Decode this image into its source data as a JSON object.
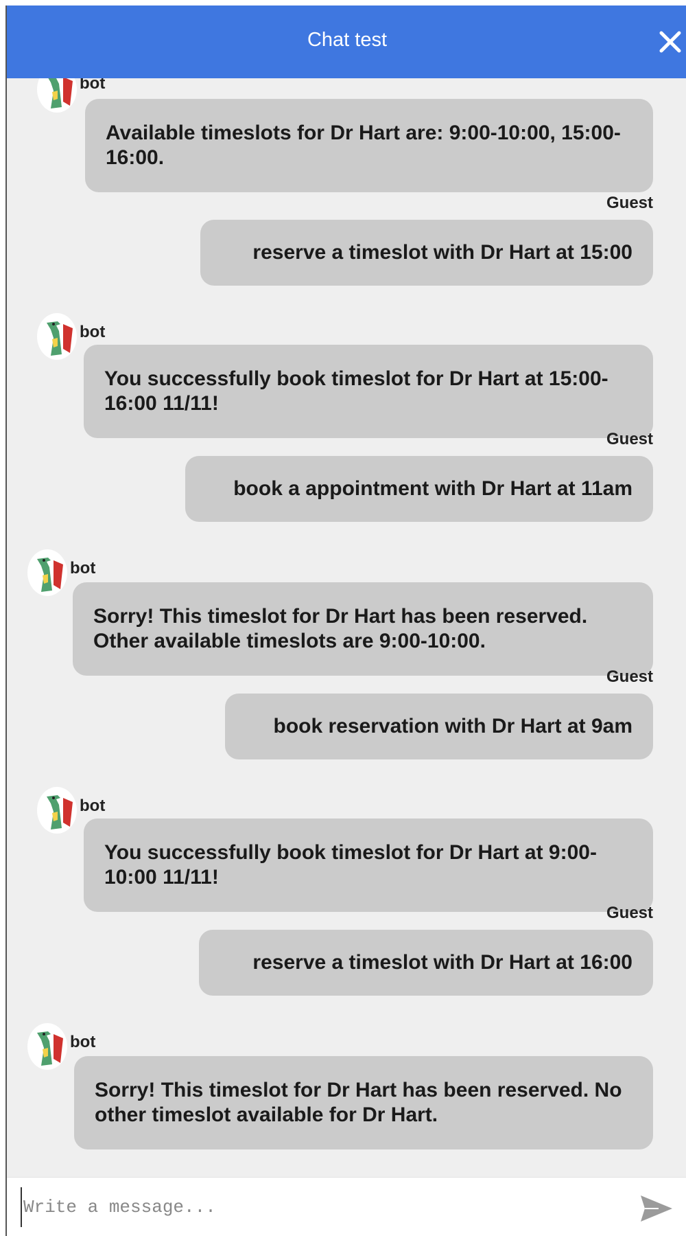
{
  "header": {
    "title": "Chat test",
    "close_icon": "close-icon"
  },
  "colors": {
    "header": "#3f77e0",
    "bubble": "#cbcbcb",
    "background": "#efefef"
  },
  "messages": [
    {
      "sender": "bot",
      "text": "Available timeslots for Dr Hart are: 9:00-10:00, 15:00-16:00."
    },
    {
      "sender": "Guest",
      "text": "reserve a timeslot with Dr Hart at 15:00"
    },
    {
      "sender": "bot",
      "text": "You successfully book timeslot for Dr Hart at 15:00-16:00 11/11!"
    },
    {
      "sender": "Guest",
      "text": "book a appointment with Dr Hart at 11am"
    },
    {
      "sender": "bot",
      "text": "Sorry! This timeslot for Dr Hart has been reserved. Other available timeslots are 9:00-10:00."
    },
    {
      "sender": "Guest",
      "text": "book reservation with Dr Hart at 9am"
    },
    {
      "sender": "bot",
      "text": "You successfully book timeslot for Dr Hart at 9:00-10:00 11/11!"
    },
    {
      "sender": "Guest",
      "text": "reserve a timeslot with Dr Hart at 16:00"
    },
    {
      "sender": "bot",
      "text": "Sorry! This timeslot for Dr Hart has been reserved. No other timeslot available for Dr Hart."
    }
  ],
  "composer": {
    "placeholder": "Write a message...",
    "send_icon": "send-icon"
  }
}
